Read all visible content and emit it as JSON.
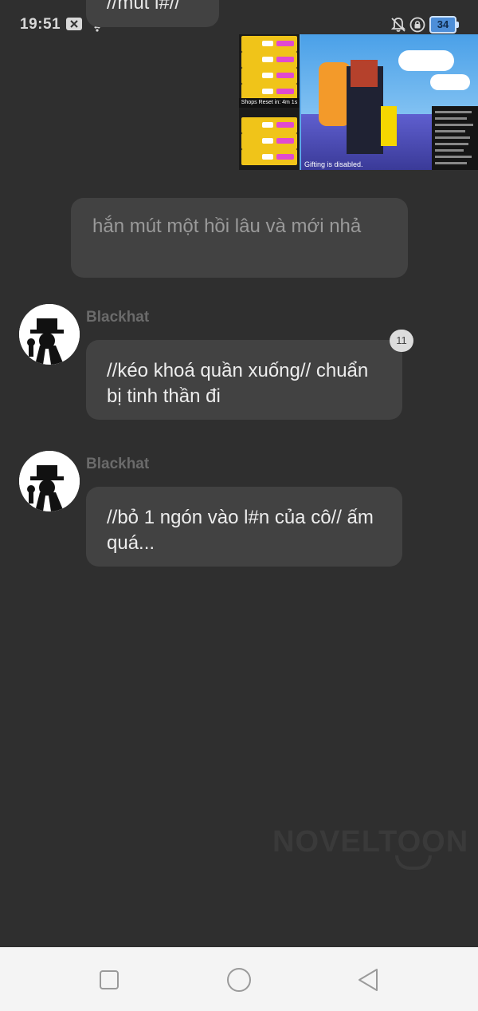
{
  "status_bar": {
    "time": "19:51",
    "battery": "34",
    "icons": [
      "close-box-icon",
      "wifi-icon",
      "bell-off-icon",
      "rotation-lock-icon",
      "battery-icon"
    ]
  },
  "chat": {
    "top_partial_message": "//mút l#//",
    "image_caption": "Gifting is disabled.",
    "image_shop_banner": "Shops Reset in: 4m 1s",
    "narration_message": "hắn mút một hồi lâu và mới nhả",
    "messages": [
      {
        "sender": "Blackhat",
        "text": "//kéo khoá quần xuống// chuẩn bị tinh thần đi",
        "badge": "11"
      },
      {
        "sender": "Blackhat",
        "text": "//bỏ 1 ngón vào l#n của cô// ấm quá..."
      }
    ]
  },
  "watermark": "NOVELTOON",
  "nav_bar": {
    "buttons": [
      "recent-apps-icon",
      "home-icon",
      "back-icon"
    ]
  },
  "colors": {
    "background": "#2f2f2f",
    "bubble": "#424242",
    "nav_bar": "#f4f4f4",
    "battery": "#4d8ed8"
  }
}
